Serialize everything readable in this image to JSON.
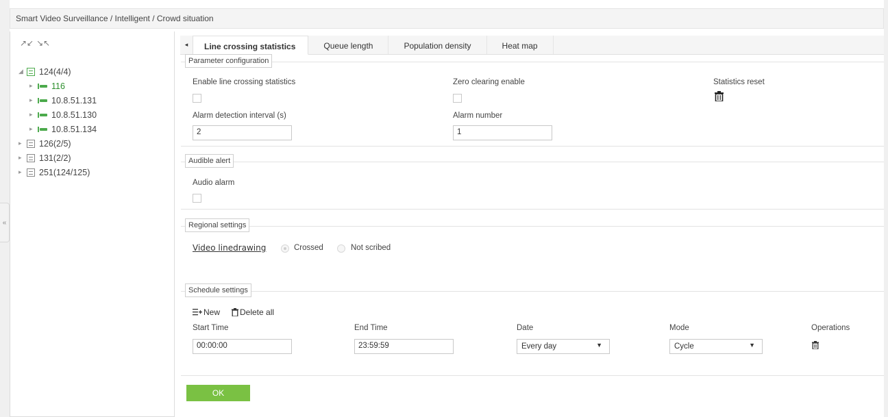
{
  "breadcrumb": "Smart Video Surveillance / Intelligent / Crowd situation",
  "left_panel": {
    "expand_glyph": "↗↙",
    "collapse_glyph": "↘↖",
    "tree": [
      {
        "label": "124(4/4)",
        "expanded": true,
        "children": [
          "116",
          "10.8.51.131",
          "10.8.51.130",
          "10.8.51.134"
        ]
      },
      {
        "label": "126(2/5)"
      },
      {
        "label": "131(2/2)"
      },
      {
        "label": "251(124/125)"
      }
    ],
    "collapse_handle": "«"
  },
  "tabs": {
    "arrow": "◂",
    "items": [
      "Line crossing statistics",
      "Queue length",
      "Population density",
      "Heat map"
    ]
  },
  "param_config": {
    "legend": "Parameter configuration",
    "enable_label": "Enable line crossing statistics",
    "zero_label": "Zero clearing enable",
    "reset_label": "Statistics reset",
    "interval_label": "Alarm detection interval (s)",
    "interval_value": "2",
    "alarm_number_label": "Alarm number",
    "alarm_number_value": "1"
  },
  "audible": {
    "legend": "Audible alert",
    "audio_label": "Audio alarm"
  },
  "regional": {
    "legend": "Regional settings",
    "draw_label": "Video linedrawing",
    "option_crossed": "Crossed",
    "option_not_scribed": "Not scribed"
  },
  "schedule": {
    "legend": "Schedule settings",
    "new_label": "New",
    "delete_all_label": "Delete all",
    "columns": {
      "start": "Start Time",
      "end": "End Time",
      "date": "Date",
      "mode": "Mode",
      "ops": "Operations"
    },
    "row": {
      "start": "00:00:00",
      "end": "23:59:59",
      "date": "Every day",
      "mode": "Cycle"
    }
  },
  "ok_label": "OK",
  "colors": {
    "accent_green": "#7ac143",
    "tree_green": "#4caa4c"
  },
  "icons": [
    "expand-icon",
    "collapse-icon",
    "trash-icon",
    "new-icon",
    "caret-down-icon"
  ]
}
